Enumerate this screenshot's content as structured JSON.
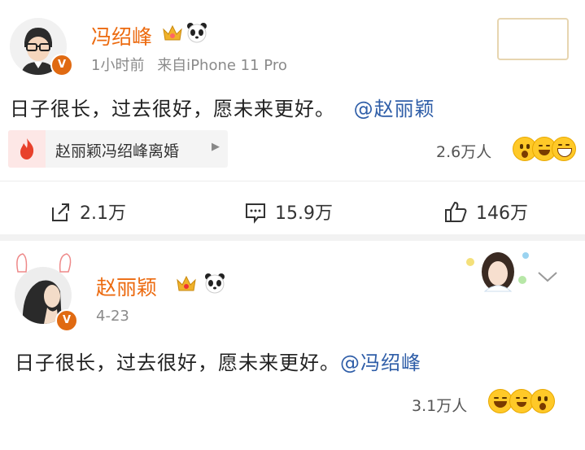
{
  "post1": {
    "user": {
      "name": "冯绍峰",
      "verified_badge": "V"
    },
    "meta": {
      "time": "1小时前",
      "source": "来自iPhone 11 Pro"
    },
    "text": {
      "body": "日子很长，过去很好，愿未来更好。",
      "mention": "@赵丽颖"
    },
    "topic": {
      "label": "赵丽颖冯绍峰离婚"
    },
    "reactions": {
      "count": "2.6万人"
    },
    "actions": {
      "repost": "2.1万",
      "comment": "15.9万",
      "like": "146万"
    }
  },
  "post2": {
    "user": {
      "name": "赵丽颖",
      "verified_badge": "V"
    },
    "meta": {
      "time": "4-23"
    },
    "text": {
      "body": "日子很长，过去很好，愿未来更好。",
      "mention": "@冯绍峰"
    },
    "reactions": {
      "count": "3.1万人"
    }
  },
  "colors": {
    "username": "#ec6a0f",
    "mention": "#2f5ea8",
    "verified": "#e06a12",
    "hot_topic": "#e8412c"
  }
}
